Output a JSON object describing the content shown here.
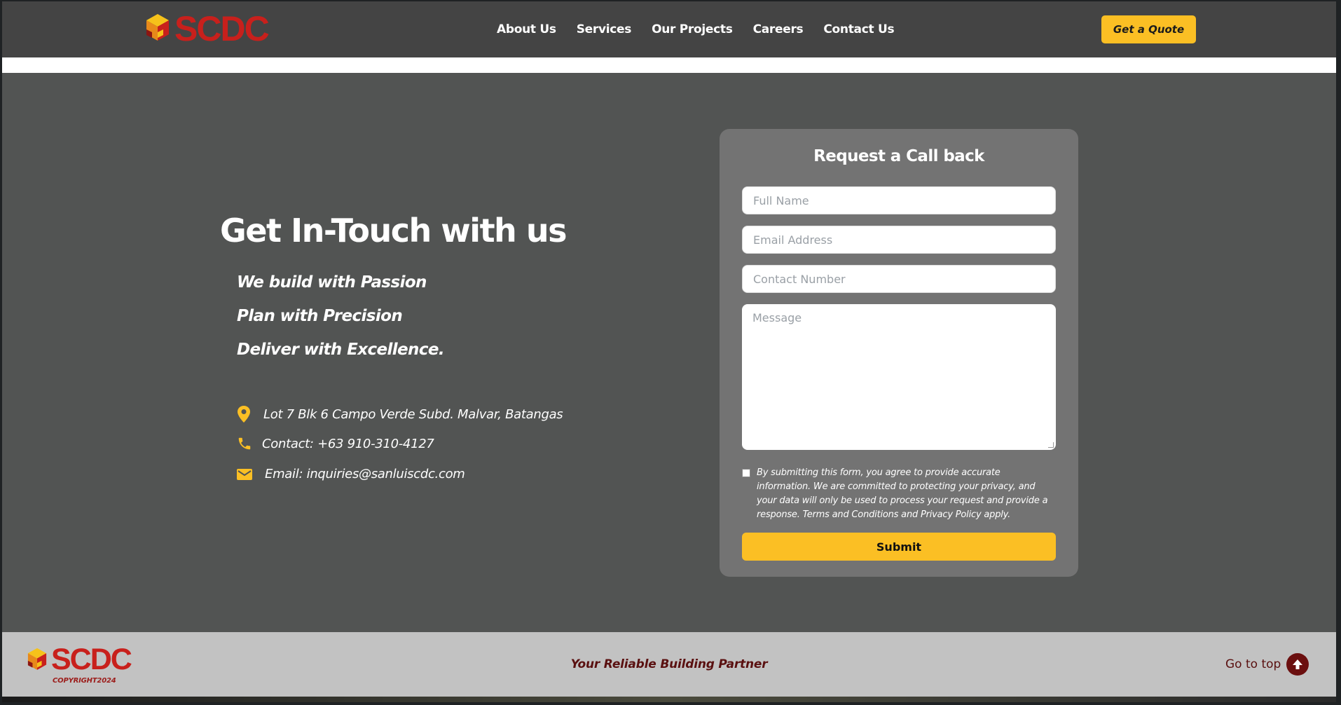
{
  "brand": {
    "name": "SCDC",
    "primary_color": "#c8201c",
    "accent_color": "#fbbf24"
  },
  "nav": {
    "links": [
      "About Us",
      "Services",
      "Our Projects",
      "Careers",
      "Contact Us"
    ],
    "quote_button": "Get a Quote"
  },
  "contact": {
    "heading": "Get In-Touch with us",
    "taglines": [
      "We build with Passion",
      "Plan with Precision",
      "Deliver with Excellence."
    ],
    "address": "Lot 7 Blk 6 Campo Verde Subd. Malvar, Batangas",
    "phone": "Contact:  +63 910-310-4127",
    "email": "Email: inquiries@sanluiscdc.com",
    "icons": [
      "map-pin-icon",
      "phone-icon",
      "mail-icon"
    ]
  },
  "form": {
    "title": "Request a Call back",
    "full_name_placeholder": "Full Name",
    "email_placeholder": "Email Address",
    "contact_placeholder": "Contact Number",
    "message_placeholder": "Message",
    "consent": "By submitting this form, you agree to provide accurate information. We are committed to protecting your privacy, and your data will only be used to process your request and provide a response. Terms and Conditions and Privacy Policy apply.",
    "submit": "Submit"
  },
  "footer": {
    "logo_text": "SCDC",
    "copyright": "COPYRIGHT2024",
    "tagline": "Your Reliable Building Partner",
    "go_to_top": "Go to top"
  }
}
